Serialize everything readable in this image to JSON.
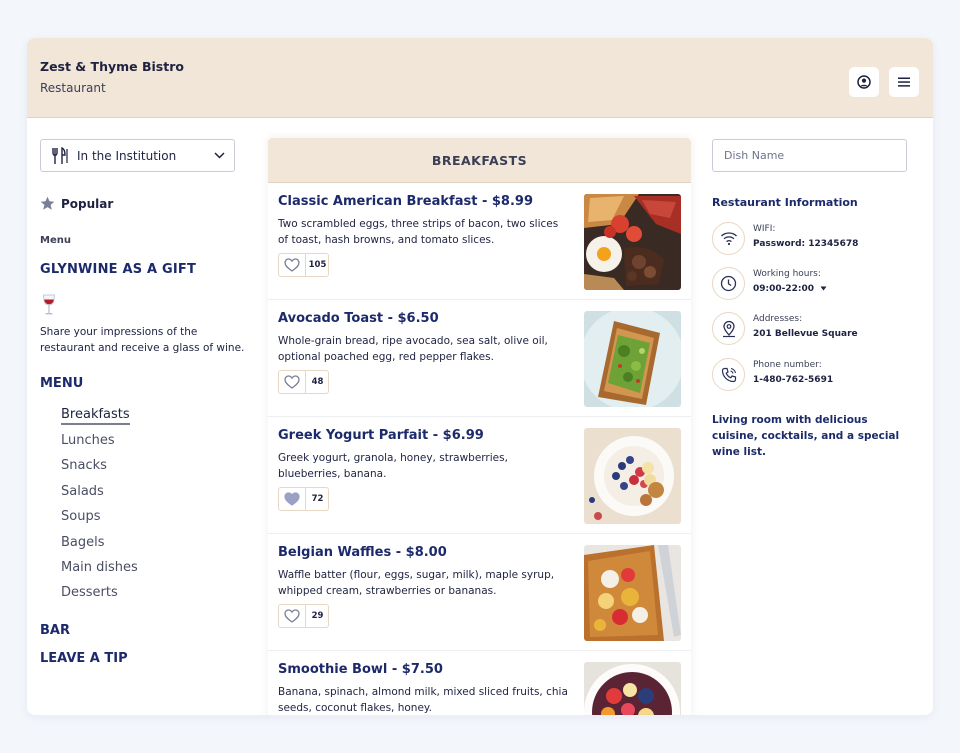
{
  "header": {
    "name": "Zest & Thyme Bistro",
    "type": "Restaurant",
    "icons": [
      "user-circle-icon",
      "hamburger-menu-icon"
    ]
  },
  "location_select": {
    "value": "In the Institution",
    "icon": "fork-knife-icon"
  },
  "sidebar": {
    "popular": "Popular",
    "menu_small_label": "Menu",
    "gift_title": "GLYNWINE AS A GIFT",
    "gift_text": "Share your impressions of the restaurant and receive a glass of wine.",
    "menu_title": "MENU",
    "menu_items": [
      "Breakfasts",
      "Lunches",
      "Snacks",
      "Salads",
      "Soups",
      "Bagels",
      "Main dishes",
      "Desserts"
    ],
    "active_item": "Breakfasts",
    "bar_title": "BAR",
    "tip_title": "LEAVE A TIP"
  },
  "section": {
    "title": "BREAKFASTS",
    "dishes": [
      {
        "title": "Classic American Breakfast - $8.99",
        "desc": "Two scrambled eggs, three strips of bacon, two slices of toast, hash browns, and tomato slices.",
        "likes": "105",
        "liked": false
      },
      {
        "title": "Avocado Toast - $6.50",
        "desc": "Whole-grain bread, ripe avocado, sea salt, olive oil, optional poached egg, red pepper flakes.",
        "likes": "48",
        "liked": false
      },
      {
        "title": "Greek Yogurt Parfait -  $6.99",
        "desc": "Greek yogurt, granola, honey, strawberries, blueberries, banana.",
        "likes": "72",
        "liked": true
      },
      {
        "title": "Belgian Waffles - $8.00",
        "desc": "Waffle batter (flour, eggs, sugar, milk), maple syrup, whipped cream, strawberries or bananas.",
        "likes": "29",
        "liked": false
      },
      {
        "title": "Smoothie Bowl - $7.50",
        "desc": "Banana, spinach, almond milk, mixed sliced fruits, chia seeds, coconut flakes, honey.",
        "likes": "",
        "liked": false
      }
    ]
  },
  "right": {
    "search_placeholder": "Dish Name",
    "info_title": "Restaurant Information",
    "wifi_label": "WIFI:",
    "wifi_value": "Password: 12345678",
    "hours_label": "Working hours:",
    "hours_value": "09:00-22:00",
    "address_label": "Addresses:",
    "address_value": "201 Bellevue Square",
    "phone_label": "Phone number:",
    "phone_value": "1-480-762-5691",
    "about": "Living room with delicious cuisine, cocktails, and a special wine list."
  },
  "colors": {
    "header_bg": "#f2e6d9",
    "primary_text": "#1c2a6b",
    "accent_border": "#e8d7c3"
  }
}
